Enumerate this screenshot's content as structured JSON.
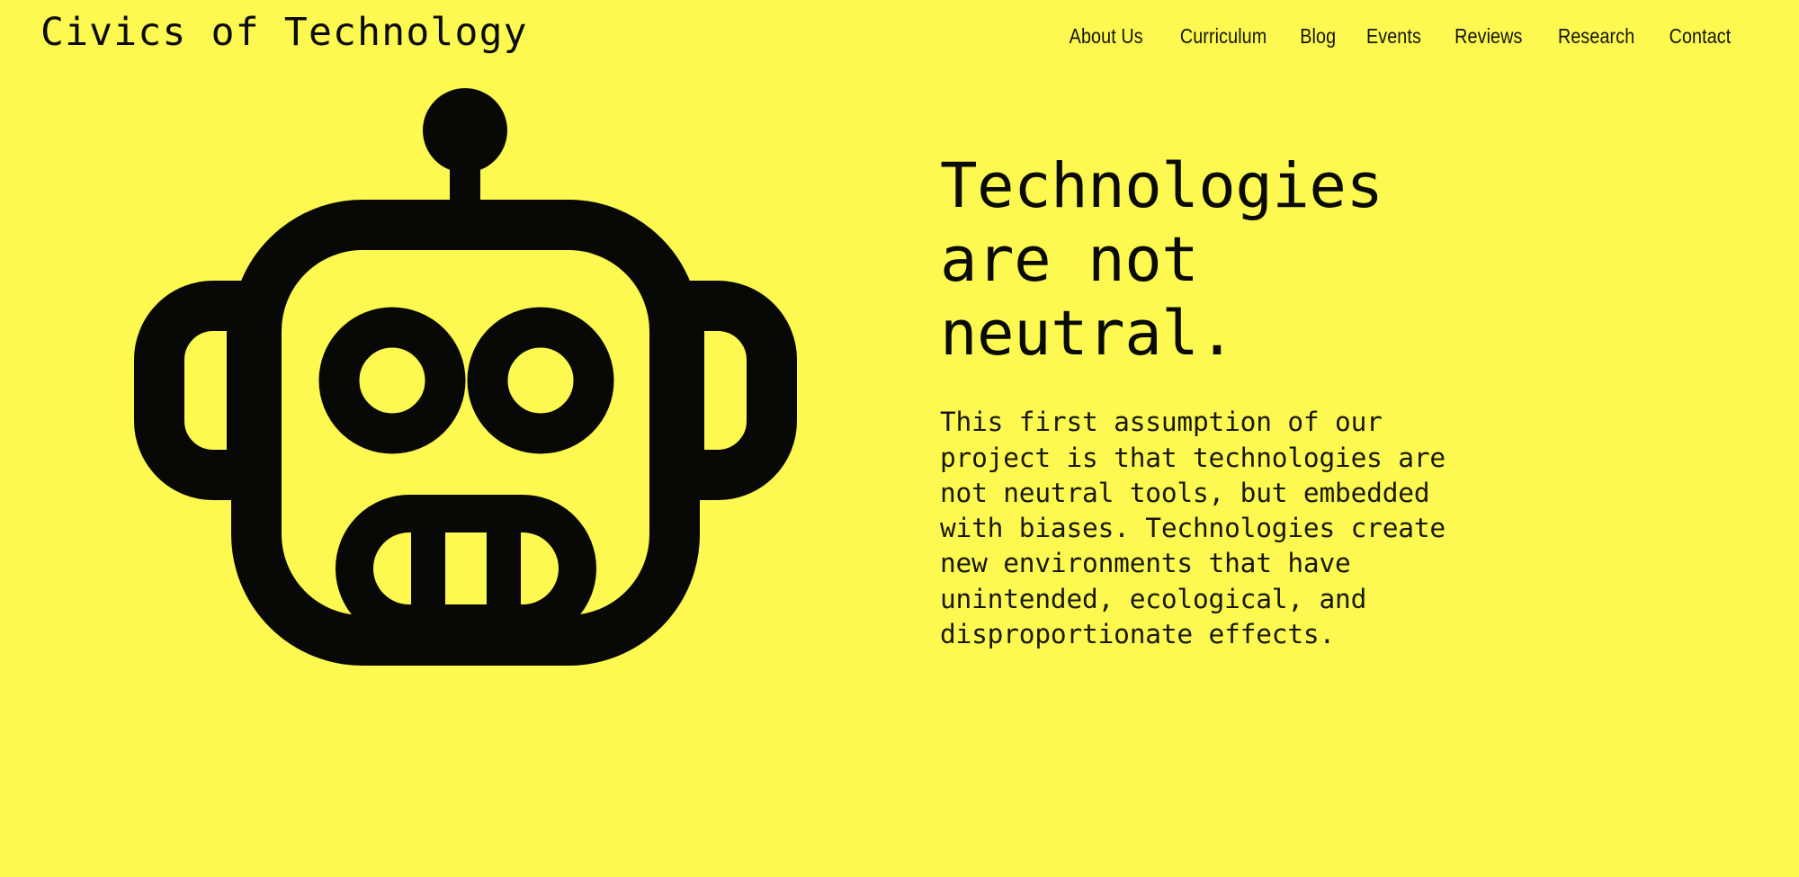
{
  "theme": {
    "background_color": "#FDF951",
    "ink_color": "#0B0B0B",
    "nav_color": "#15150B"
  },
  "header": {
    "site_title": "Civics of Technology",
    "nav_items": [
      {
        "label": "About Us"
      },
      {
        "label": "Curriculum"
      },
      {
        "label": "Blog"
      },
      {
        "label": "Events"
      },
      {
        "label": "Reviews"
      },
      {
        "label": "Research"
      },
      {
        "label": "Contact"
      }
    ]
  },
  "hero": {
    "illustration": "robot-head-icon",
    "headline": "Technologies are not neutral.",
    "body": "This first assumption of our project is that technologies are not neutral tools, but embedded with biases. Technologies create new environments that have unintended, ecological, and disproportionate effects."
  }
}
